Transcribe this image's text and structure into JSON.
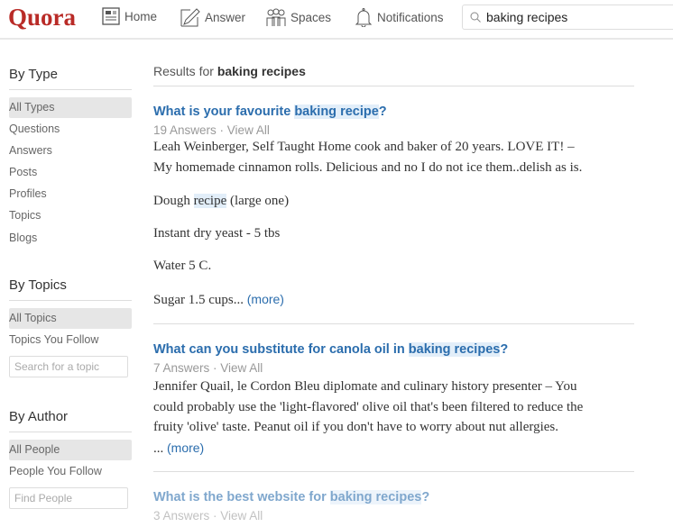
{
  "header": {
    "logo": "Quora",
    "nav": [
      {
        "label": "Home",
        "icon": "newspaper-icon"
      },
      {
        "label": "Answer",
        "icon": "pencil-icon"
      },
      {
        "label": "Spaces",
        "icon": "people-icon"
      },
      {
        "label": "Notifications",
        "icon": "bell-icon"
      }
    ],
    "search_value": "baking recipes"
  },
  "sidebar": {
    "by_type": {
      "title": "By Type",
      "items": [
        "All Types",
        "Questions",
        "Answers",
        "Posts",
        "Profiles",
        "Topics",
        "Blogs"
      ],
      "selected": "All Types"
    },
    "by_topics": {
      "title": "By Topics",
      "items": [
        "All Topics",
        "Topics You Follow"
      ],
      "placeholder": "Search for a topic"
    },
    "by_author": {
      "title": "By Author",
      "items": [
        "All People",
        "People You Follow"
      ],
      "placeholder": "Find People"
    }
  },
  "main": {
    "results_prefix": "Results for",
    "query": "baking recipes",
    "results": [
      {
        "title_pre": "What is your favourite ",
        "title_mark": "baking recipe",
        "title_post": "?",
        "answers": "19 Answers",
        "view_all": "View All",
        "lines": [
          "Leah Weinberger, Self Taught Home cook and baker of 20 years. LOVE IT! –",
          "My homemade cinnamon rolls. Delicious and no I do not ice them..delish as is."
        ],
        "p2_pre": "Dough ",
        "p2_mark": "recipe",
        "p2_post": " (large one)",
        "p3": "Instant dry yeast - 5 tbs",
        "p4": "Water 5 C.",
        "p5": "Sugar 1.5 cups...",
        "more": "(more)"
      },
      {
        "title_pre": "What can you substitute for canola oil in ",
        "title_mark": "baking recipes",
        "title_post": "?",
        "answers": "7 Answers",
        "view_all": "View All",
        "lines": [
          "Jennifer Quail, le Cordon Bleu diplomate and culinary history presenter – You",
          "could probably use the 'light-flavored' olive oil that's been filtered to reduce the",
          "fruity 'olive' taste.  Peanut oil if you don't have to worry about nut allergies."
        ],
        "tail": "...",
        "more": "(more)"
      },
      {
        "title_pre": "What is the best website for ",
        "title_mark": "baking recipes",
        "title_post": "?",
        "answers": "3 Answers",
        "view_all": "View All"
      }
    ]
  }
}
